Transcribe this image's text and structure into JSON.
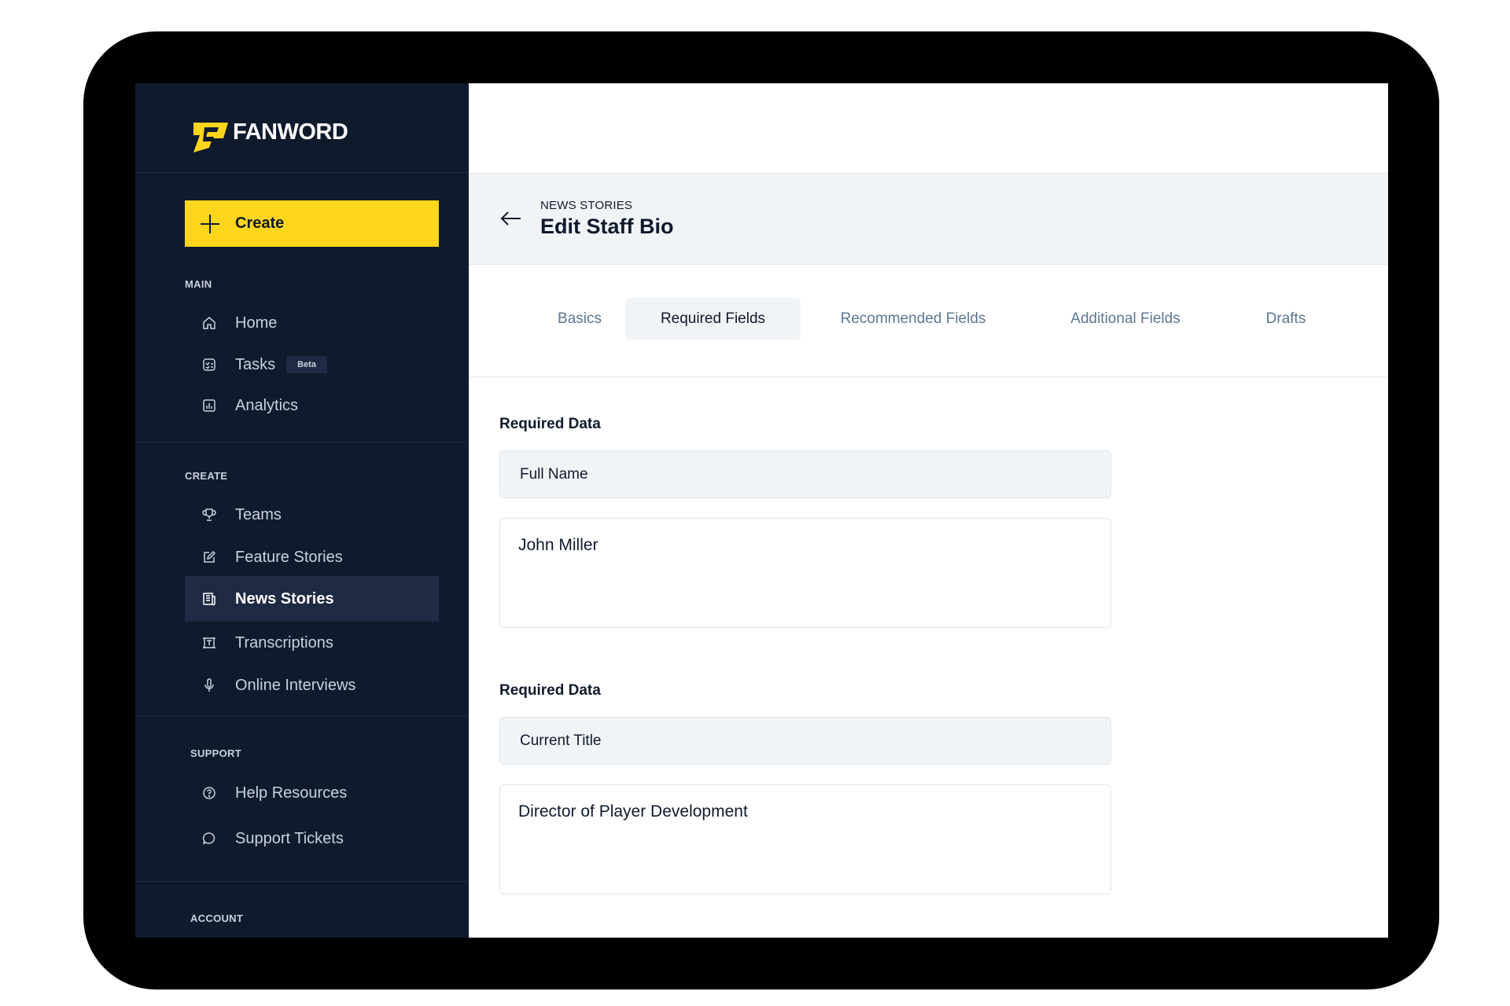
{
  "brand": {
    "name": "FANWORD",
    "accent": "#ffd61c",
    "sidebar_bg": "#101a2d"
  },
  "sidebar": {
    "create_label": "Create",
    "sections": {
      "main": "MAIN",
      "create": "CREATE",
      "support": "SUPPORT",
      "account": "ACCOUNT"
    },
    "main_items": [
      {
        "label": "Home",
        "icon": "home-icon"
      },
      {
        "label": "Tasks",
        "icon": "tasks-icon",
        "badge": "Beta"
      },
      {
        "label": "Analytics",
        "icon": "analytics-icon"
      }
    ],
    "create_items": [
      {
        "label": "Teams",
        "icon": "trophy-icon"
      },
      {
        "label": "Feature Stories",
        "icon": "edit-icon"
      },
      {
        "label": "News Stories",
        "icon": "newspaper-icon",
        "active": true
      },
      {
        "label": "Transcriptions",
        "icon": "transcription-icon"
      },
      {
        "label": "Online Interviews",
        "icon": "microphone-icon"
      }
    ],
    "support_items": [
      {
        "label": "Help Resources",
        "icon": "help-icon"
      },
      {
        "label": "Support Tickets",
        "icon": "chat-icon"
      }
    ]
  },
  "header": {
    "breadcrumb": "NEWS STORIES",
    "title": "Edit Staff Bio"
  },
  "tabs": [
    {
      "label": "Basics"
    },
    {
      "label": "Required Fields",
      "active": true
    },
    {
      "label": "Recommended Fields"
    },
    {
      "label": "Additional Fields"
    },
    {
      "label": "Drafts"
    }
  ],
  "form": {
    "sections": [
      {
        "label": "Required Data",
        "field": "Full Name",
        "value": "John Miller"
      },
      {
        "label": "Required Data",
        "field": "Current Title",
        "value": "Director of Player Development"
      }
    ]
  }
}
